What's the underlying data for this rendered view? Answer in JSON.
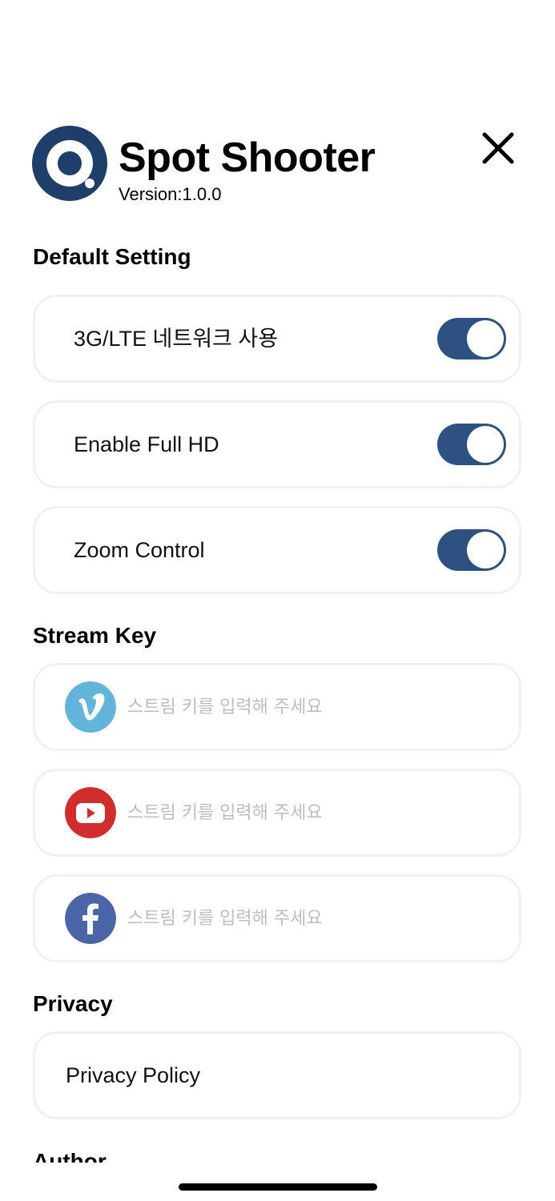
{
  "header": {
    "app_name": "Spot Shooter",
    "version": "Version:1.0.0",
    "logo_icon": "spot-shooter-logo",
    "close_icon": "close-icon"
  },
  "sections": {
    "default_setting": {
      "title": "Default Setting",
      "rows": [
        {
          "label": "3G/LTE 네트워크 사용",
          "enabled": true
        },
        {
          "label": "Enable Full HD",
          "enabled": true
        },
        {
          "label": "Zoom Control",
          "enabled": true
        }
      ]
    },
    "stream_key": {
      "title": "Stream Key",
      "rows": [
        {
          "service": "vimeo",
          "icon": "vimeo-icon",
          "value": "",
          "placeholder": "스트림 키를 입력해 주세요"
        },
        {
          "service": "youtube",
          "icon": "youtube-icon",
          "value": "",
          "placeholder": "스트림 키를 입력해 주세요"
        },
        {
          "service": "facebook",
          "icon": "facebook-icon",
          "value": "",
          "placeholder": "스트림 키를 입력해 주세요"
        }
      ]
    },
    "privacy": {
      "title": "Privacy",
      "policy_label": "Privacy Policy"
    },
    "next_section_partial": {
      "title": "Author"
    }
  },
  "colors": {
    "accent": "#2d5281",
    "logo": "#1f3f6b",
    "vimeo": "#62b4d9",
    "youtube": "#d22d2d",
    "facebook": "#4a66a8",
    "placeholder": "#bdbdbd",
    "card_border": "#f1f1f1"
  }
}
